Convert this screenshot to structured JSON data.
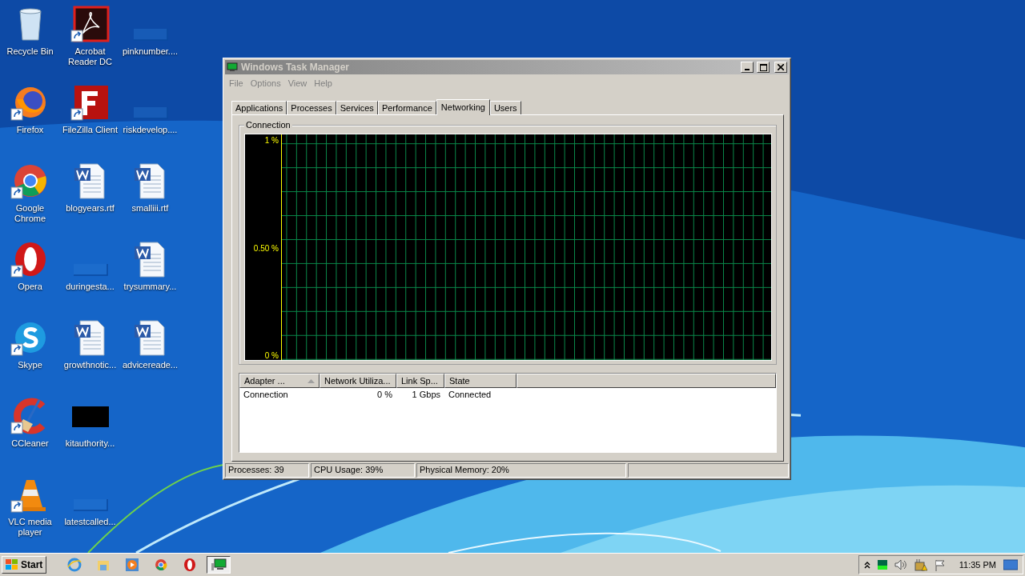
{
  "desktop": {
    "columns": [
      [
        {
          "label": "Recycle Bin",
          "kind": "recycle",
          "shortcut": false
        },
        {
          "label": "Firefox",
          "kind": "firefox",
          "shortcut": true
        },
        {
          "label": "Google Chrome",
          "kind": "chrome",
          "shortcut": true
        },
        {
          "label": "Opera",
          "kind": "opera",
          "shortcut": true
        },
        {
          "label": "Skype",
          "kind": "skype",
          "shortcut": true
        },
        {
          "label": "CCleaner",
          "kind": "ccleaner",
          "shortcut": true
        },
        {
          "label": "VLC media player",
          "kind": "vlc",
          "shortcut": true
        }
      ],
      [
        {
          "label": "Acrobat Reader DC",
          "kind": "acrobat",
          "shortcut": true
        },
        {
          "label": "FileZilla Client",
          "kind": "filezilla",
          "shortcut": true
        },
        {
          "label": "blogyears.rtf",
          "kind": "word",
          "shortcut": false
        },
        {
          "label": "duringesta...",
          "kind": "blank",
          "shortcut": false
        },
        {
          "label": "growthnotic...",
          "kind": "word",
          "shortcut": false
        },
        {
          "label": "kitauthority...",
          "kind": "black",
          "shortcut": false
        },
        {
          "label": "latestcalled...",
          "kind": "blank",
          "shortcut": false
        }
      ],
      [
        {
          "label": "pinknumber....",
          "kind": "blank",
          "shortcut": false
        },
        {
          "label": "riskdevelop....",
          "kind": "blank",
          "shortcut": false
        },
        {
          "label": "smalliii.rtf",
          "kind": "word",
          "shortcut": false
        },
        {
          "label": "trysummary...",
          "kind": "word",
          "shortcut": false
        },
        {
          "label": "advicereade...",
          "kind": "word",
          "shortcut": false
        }
      ]
    ]
  },
  "window": {
    "title": "Windows Task Manager",
    "active": false,
    "menu": [
      "File",
      "Options",
      "View",
      "Help"
    ],
    "tabs": [
      {
        "label": "Applications",
        "selected": false
      },
      {
        "label": "Processes",
        "selected": false
      },
      {
        "label": "Services",
        "selected": false
      },
      {
        "label": "Performance",
        "selected": false
      },
      {
        "label": "Networking",
        "selected": true
      },
      {
        "label": "Users",
        "selected": false
      }
    ],
    "graph": {
      "title": "Connection",
      "scale_labels": [
        "1 %",
        "0.50 %",
        "0 %"
      ]
    },
    "table": {
      "columns": [
        {
          "label": "Adapter ...",
          "sorted": true
        },
        {
          "label": "Network Utiliza...",
          "sorted": false
        },
        {
          "label": "Link Sp...",
          "sorted": false
        },
        {
          "label": "State",
          "sorted": false
        }
      ],
      "rows": [
        [
          "Connection",
          "0 %",
          "1 Gbps",
          "Connected"
        ]
      ]
    },
    "status_bar": [
      "Processes: 39",
      "CPU Usage: 39%",
      "Physical Memory: 20%"
    ]
  },
  "taskbar": {
    "start": "Start",
    "apps": [
      {
        "kind": "ie",
        "selected": false
      },
      {
        "kind": "explorer",
        "selected": false
      },
      {
        "kind": "media",
        "selected": false
      },
      {
        "kind": "chrome",
        "selected": false
      },
      {
        "kind": "opera",
        "selected": false
      },
      {
        "kind": "taskmgr",
        "selected": true
      }
    ],
    "clock": "11:35 PM"
  }
}
